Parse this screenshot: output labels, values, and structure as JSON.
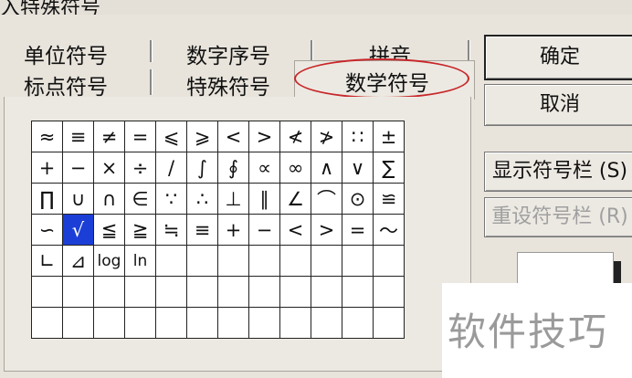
{
  "window": {
    "title": "入特殊符号"
  },
  "tabs": [
    {
      "label": "单位符号"
    },
    {
      "label": "数字序号"
    },
    {
      "label": "拼音"
    },
    {
      "label": "标点符号"
    },
    {
      "label": "特殊符号"
    },
    {
      "label": "数学符号",
      "active": true
    }
  ],
  "symbols": {
    "rows": [
      [
        "≈",
        "≡",
        "≠",
        "=",
        "⩽",
        "⩾",
        "<",
        ">",
        "≮",
        "≯",
        "∷",
        "±"
      ],
      [
        "+",
        "−",
        "×",
        "÷",
        "/",
        "∫",
        "∮",
        "∝",
        "∞",
        "∧",
        "∨",
        "∑"
      ],
      [
        "∏",
        "∪",
        "∩",
        "∈",
        "∵",
        "∴",
        "⊥",
        "∥",
        "∠",
        "⌒",
        "⊙",
        "≌"
      ],
      [
        "∽",
        "√",
        "≦",
        "≧",
        "≒",
        "≡",
        "+",
        "−",
        "<",
        ">",
        "=",
        "～"
      ],
      [
        "∟",
        "⊿",
        "log",
        "ln",
        "",
        "",
        "",
        "",
        "",
        "",
        "",
        ""
      ],
      [
        "",
        "",
        "",
        "",
        "",
        "",
        "",
        "",
        "",
        "",
        "",
        ""
      ],
      [
        "",
        "",
        "",
        "",
        "",
        "",
        "",
        "",
        "",
        "",
        "",
        ""
      ]
    ],
    "selected": "√"
  },
  "buttons": {
    "ok": "确定",
    "cancel": "取消",
    "show_bar": "显示符号栏 (S)",
    "reset_bar": "重设符号栏 (R)"
  },
  "watermark": "软件技巧"
}
